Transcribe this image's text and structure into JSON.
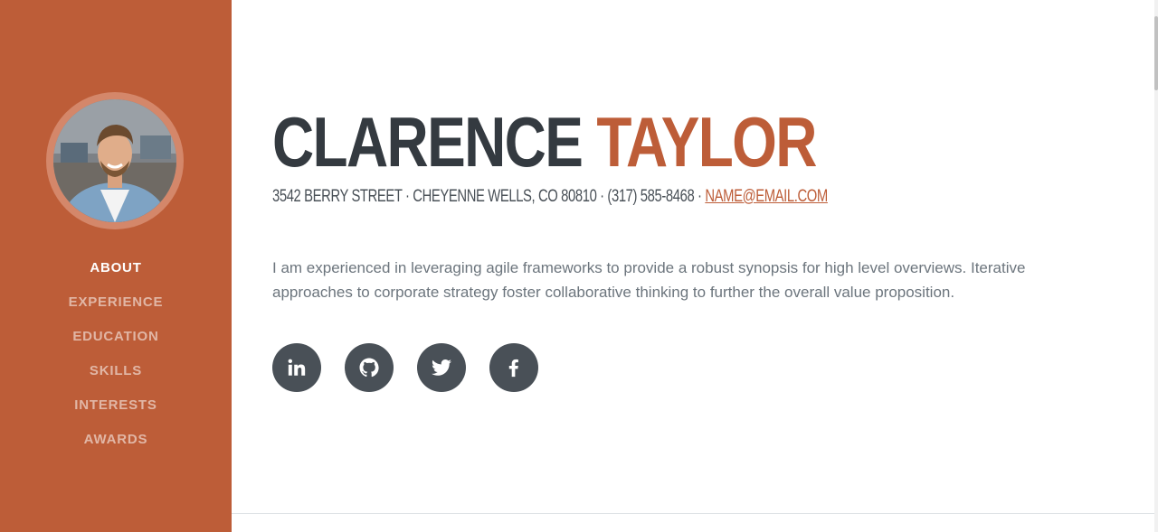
{
  "profile": {
    "first_name": "CLARENCE",
    "last_name": "TAYLOR",
    "address": "3542 BERRY STREET · CHEYENNE WELLS, CO 80810 · (317) 585-8468 · ",
    "email": "NAME@EMAIL.COM",
    "bio": "I am experienced in leveraging agile frameworks to provide a robust synopsis for high level overviews. Iterative approaches to corporate strategy foster collaborative thinking to further the overall value proposition."
  },
  "nav": {
    "items": [
      {
        "label": "ABOUT",
        "active": true
      },
      {
        "label": "EXPERIENCE",
        "active": false
      },
      {
        "label": "EDUCATION",
        "active": false
      },
      {
        "label": "SKILLS",
        "active": false
      },
      {
        "label": "INTERESTS",
        "active": false
      },
      {
        "label": "AWARDS",
        "active": false
      }
    ]
  },
  "social": [
    {
      "icon": "linkedin-icon"
    },
    {
      "icon": "github-icon"
    },
    {
      "icon": "twitter-icon"
    },
    {
      "icon": "facebook-icon"
    }
  ],
  "colors": {
    "primary": "#bd5d38",
    "dark": "#343a40",
    "social_bg": "#495057",
    "text_muted": "#6c757d"
  }
}
